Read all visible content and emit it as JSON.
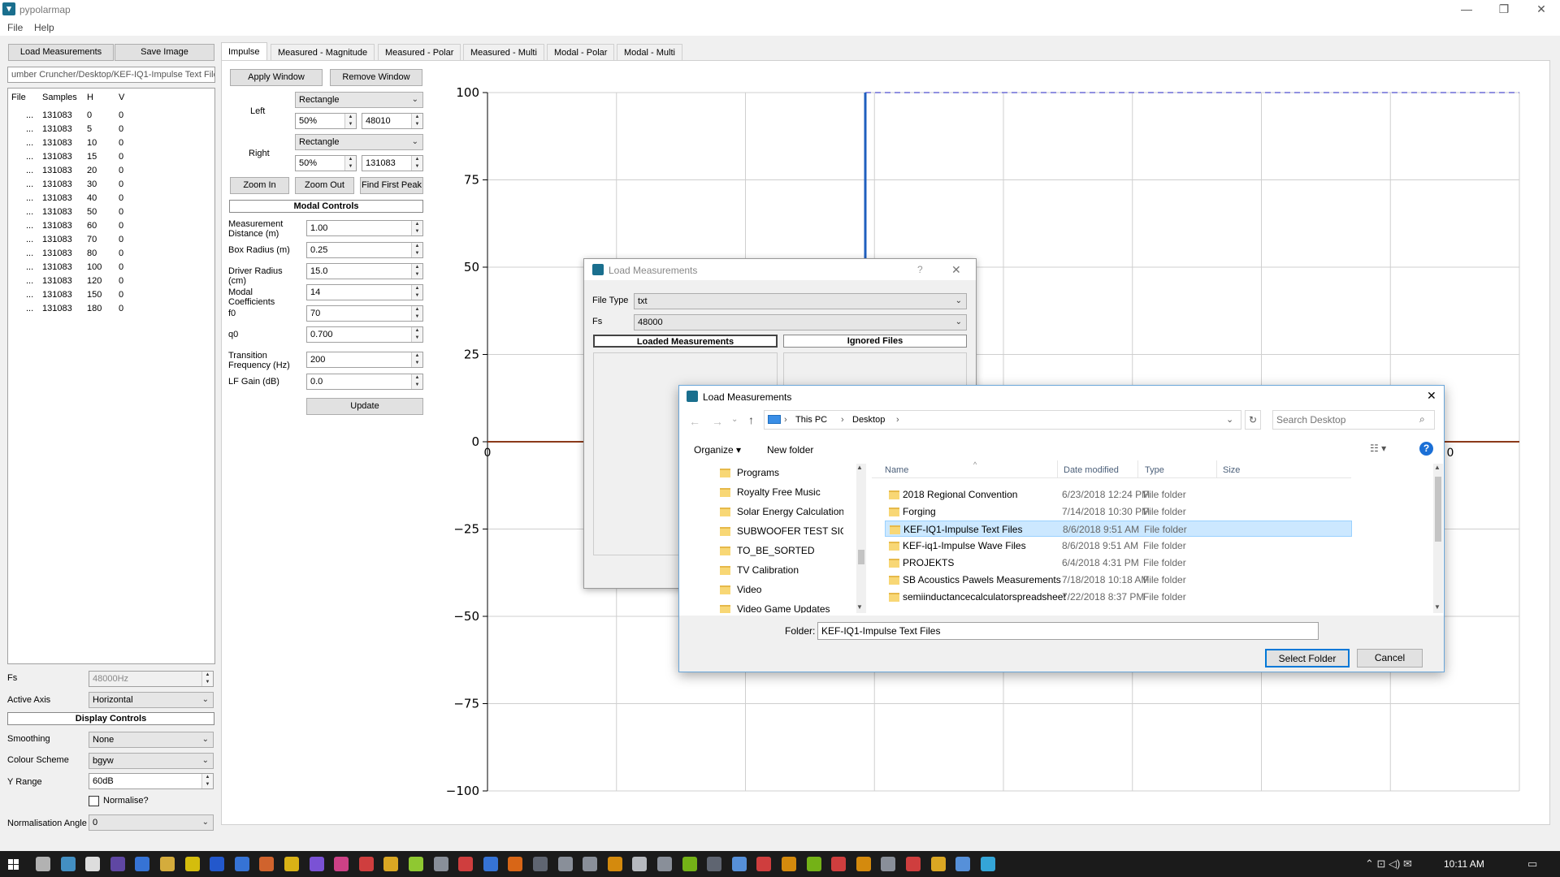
{
  "window": {
    "title": "pypolarmap",
    "menu": [
      "File",
      "Help"
    ],
    "controls": {
      "minimize": "—",
      "restore": "❐",
      "close": "✕"
    }
  },
  "left_panel": {
    "load_button": "Load Measurements",
    "save_button": "Save Image",
    "path": "umber Cruncher/Desktop/KEF-IQ1-Impulse Text Files",
    "columns": [
      "File",
      "Samples",
      "H",
      "V"
    ],
    "rows": [
      {
        "file": "...",
        "samples": "131083",
        "h": "0",
        "v": "0"
      },
      {
        "file": "...",
        "samples": "131083",
        "h": "5",
        "v": "0"
      },
      {
        "file": "...",
        "samples": "131083",
        "h": "10",
        "v": "0"
      },
      {
        "file": "...",
        "samples": "131083",
        "h": "15",
        "v": "0"
      },
      {
        "file": "...",
        "samples": "131083",
        "h": "20",
        "v": "0"
      },
      {
        "file": "...",
        "samples": "131083",
        "h": "30",
        "v": "0"
      },
      {
        "file": "...",
        "samples": "131083",
        "h": "40",
        "v": "0"
      },
      {
        "file": "...",
        "samples": "131083",
        "h": "50",
        "v": "0"
      },
      {
        "file": "...",
        "samples": "131083",
        "h": "60",
        "v": "0"
      },
      {
        "file": "...",
        "samples": "131083",
        "h": "70",
        "v": "0"
      },
      {
        "file": "...",
        "samples": "131083",
        "h": "80",
        "v": "0"
      },
      {
        "file": "...",
        "samples": "131083",
        "h": "100",
        "v": "0"
      },
      {
        "file": "...",
        "samples": "131083",
        "h": "120",
        "v": "0"
      },
      {
        "file": "...",
        "samples": "131083",
        "h": "150",
        "v": "0"
      },
      {
        "file": "...",
        "samples": "131083",
        "h": "180",
        "v": "0"
      }
    ],
    "fs_label": "Fs",
    "fs_value": "48000Hz",
    "active_axis_label": "Active Axis",
    "active_axis_value": "Horizontal",
    "display_controls": "Display Controls",
    "smoothing_label": "Smoothing",
    "smoothing_value": "None",
    "colour_label": "Colour Scheme",
    "colour_value": "bgyw",
    "yrange_label": "Y Range",
    "yrange_value": "60dB",
    "normalise_label": "Normalise?",
    "norm_angle_label": "Normalisation Angle",
    "norm_angle_value": "0"
  },
  "tabs": [
    "Impulse",
    "Measured - Magnitude",
    "Measured - Polar",
    "Measured - Multi",
    "Modal - Polar",
    "Modal - Multi"
  ],
  "impulse_controls": {
    "apply_window": "Apply Window",
    "remove_window": "Remove Window",
    "left_label": "Left",
    "left_type": "Rectangle",
    "left_pct": "50%",
    "left_samples": "48010",
    "right_label": "Right",
    "right_type": "Rectangle",
    "right_pct": "50%",
    "right_samples": "131083",
    "zoom_in": "Zoom In",
    "zoom_out": "Zoom Out",
    "find_peak": "Find First Peak"
  },
  "modal_controls": {
    "header": "Modal Controls",
    "fields": [
      {
        "label": "Measurement Distance (m)",
        "value": "1.00"
      },
      {
        "label": "Box Radius (m)",
        "value": "0.25"
      },
      {
        "label": "Driver Radius (cm)",
        "value": "15.0"
      },
      {
        "label": "Modal Coefficients",
        "value": "14"
      },
      {
        "label": "f0",
        "value": "70"
      },
      {
        "label": "q0",
        "value": "0.700"
      },
      {
        "label": "Transition Frequency (Hz)",
        "value": "200"
      },
      {
        "label": "LF Gain (dB)",
        "value": "0.0"
      }
    ],
    "update": "Update"
  },
  "chart_data": {
    "type": "line",
    "yticks": [
      100,
      75,
      50,
      25,
      0,
      -25,
      -50,
      -75,
      -100
    ],
    "ylim": [
      -100,
      100
    ],
    "xtick_left": "0",
    "xtick_right": "0",
    "grid": true,
    "colors": {
      "impulse_upper": "#1f5fbf",
      "impulse_lower": "#55a832",
      "baseline": "#8b3a1a",
      "dashed": "#6b6bd6"
    }
  },
  "dialog_load": {
    "title": "Load Measurements",
    "help": "?",
    "close": "✕",
    "file_type_label": "File Type",
    "file_type_value": "txt",
    "fs_label": "Fs",
    "fs_value": "48000",
    "loaded_tab": "Loaded Measurements",
    "ignored_tab": "Ignored Files"
  },
  "dialog_folder": {
    "title": "Load Measurements",
    "close": "✕",
    "breadcrumb": [
      "This PC",
      "Desktop"
    ],
    "search_placeholder": "Search Desktop",
    "organize": "Organize ▾",
    "new_folder": "New folder",
    "tree": [
      "Programs",
      "Royalty Free Music",
      "Solar Energy Calculation Progr",
      "SUBWOOFER TEST SIGNALS",
      "TO_BE_SORTED",
      "TV Calibration",
      "Video",
      "Video Game Updates"
    ],
    "columns": [
      "Name",
      "Date modified",
      "Type",
      "Size"
    ],
    "files": [
      {
        "name": "2018 Regional Convention",
        "date": "6/23/2018 12:24 PM",
        "type": "File folder"
      },
      {
        "name": "Forging",
        "date": "7/14/2018 10:30 PM",
        "type": "File folder"
      },
      {
        "name": "KEF-IQ1-Impulse Text Files",
        "date": "8/6/2018 9:51 AM",
        "type": "File folder"
      },
      {
        "name": "KEF-iq1-Impulse Wave Files",
        "date": "8/6/2018 9:51 AM",
        "type": "File folder"
      },
      {
        "name": "PROJEKTS",
        "date": "6/4/2018 4:31 PM",
        "type": "File folder"
      },
      {
        "name": "SB Acoustics Pawels Measurements",
        "date": "7/18/2018 10:18 AM",
        "type": "File folder"
      },
      {
        "name": "semiinductancecalculatorspreadsheet",
        "date": "7/22/2018 8:37 PM",
        "type": "File folder"
      }
    ],
    "folder_label": "Folder:",
    "folder_value": "KEF-IQ1-Impulse Text Files",
    "select_button": "Select Folder",
    "cancel_button": "Cancel"
  },
  "taskbar": {
    "time": "10:11 AM"
  }
}
